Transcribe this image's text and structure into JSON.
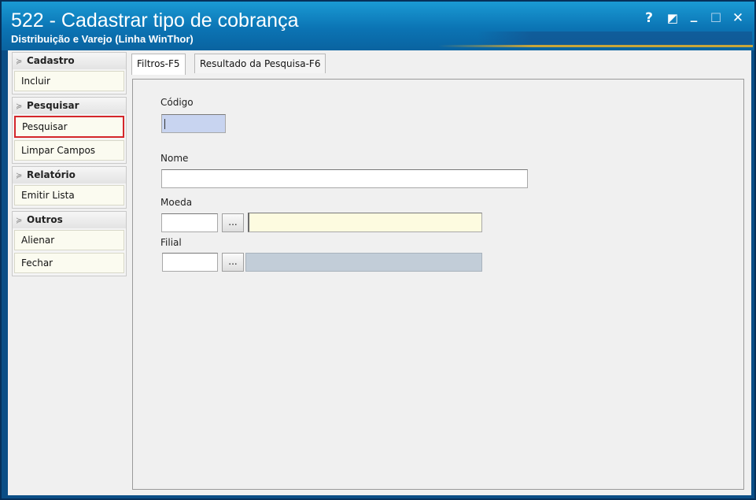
{
  "window": {
    "title": "522 - Cadastrar tipo de cobrança",
    "subtitle": "Distribuição e Varejo (Linha WinThor)",
    "controls": {
      "help": "?",
      "theme": "◩",
      "minimize": "_",
      "maximize": "☐",
      "close": "✕"
    }
  },
  "sidebar": {
    "groups": [
      {
        "label": "Cadastro",
        "items": [
          "Incluir"
        ]
      },
      {
        "label": "Pesquisar",
        "items": [
          "Pesquisar",
          "Limpar Campos"
        ]
      },
      {
        "label": "Relatório",
        "items": [
          "Emitir Lista"
        ]
      },
      {
        "label": "Outros",
        "items": [
          "Alienar",
          "Fechar"
        ]
      }
    ]
  },
  "tabs": [
    "Filtros-F5",
    "Resultado da Pesquisa-F6"
  ],
  "form": {
    "codigo_label": "Código",
    "nome_label": "Nome",
    "moeda_label": "Moeda",
    "filial_label": "Filial",
    "dots_label": "...",
    "codigo_value": "",
    "nome_value": "",
    "moeda_code": "",
    "moeda_desc": "",
    "filial_code": "",
    "filial_desc": ""
  },
  "colors": {
    "codigo_bg": "#c8d4f0",
    "moeda_desc_bg": "#fdfbe0",
    "filial_desc_bg": "#c2cdd8",
    "highlight": "#d4262b"
  }
}
